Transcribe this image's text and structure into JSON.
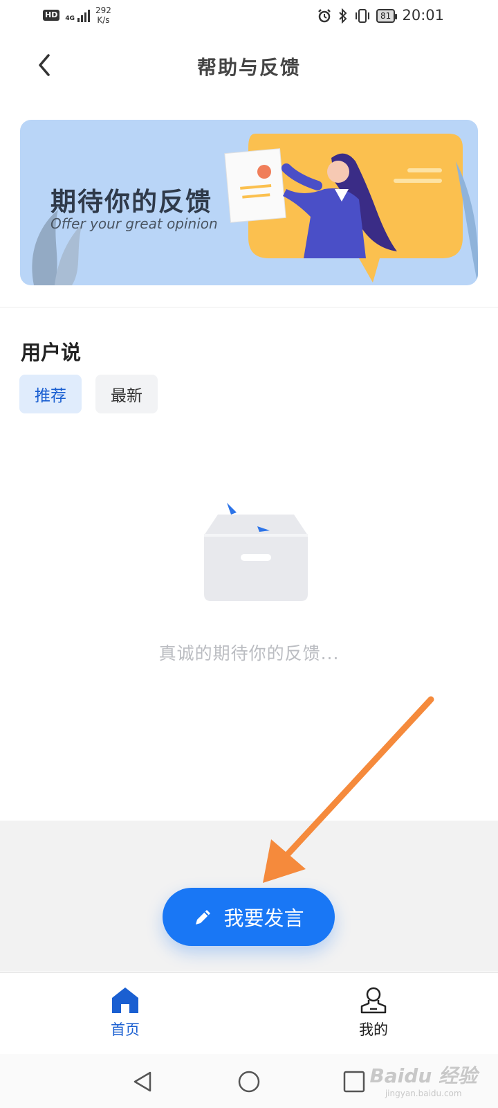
{
  "status_bar": {
    "hd_label": "HD",
    "network_label": "4G",
    "speed_value": "292",
    "speed_unit": "K/s",
    "battery": "81",
    "time": "20:01"
  },
  "header": {
    "title": "帮助与反馈"
  },
  "banner": {
    "title": "期待你的反馈",
    "subtitle": "Offer your great opinion"
  },
  "section": {
    "title": "用户说",
    "tabs": [
      {
        "label": "推荐",
        "active": true
      },
      {
        "label": "最新",
        "active": false
      }
    ]
  },
  "empty_state": {
    "text": "真诚的期待你的反馈..."
  },
  "post_button": {
    "label": "我要发言",
    "icon": "pencil-icon"
  },
  "bottom_nav": {
    "items": [
      {
        "label": "首页",
        "icon": "home-icon",
        "active": true
      },
      {
        "label": "我的",
        "icon": "user-icon",
        "active": false
      }
    ]
  },
  "watermark": {
    "main": "Baidu 经验",
    "sub": "jingyan.baidu.com"
  },
  "colors": {
    "accent": "#1977f5",
    "tab_active_bg": "#e0ecfc",
    "annotation_arrow": "#f58a3c"
  }
}
